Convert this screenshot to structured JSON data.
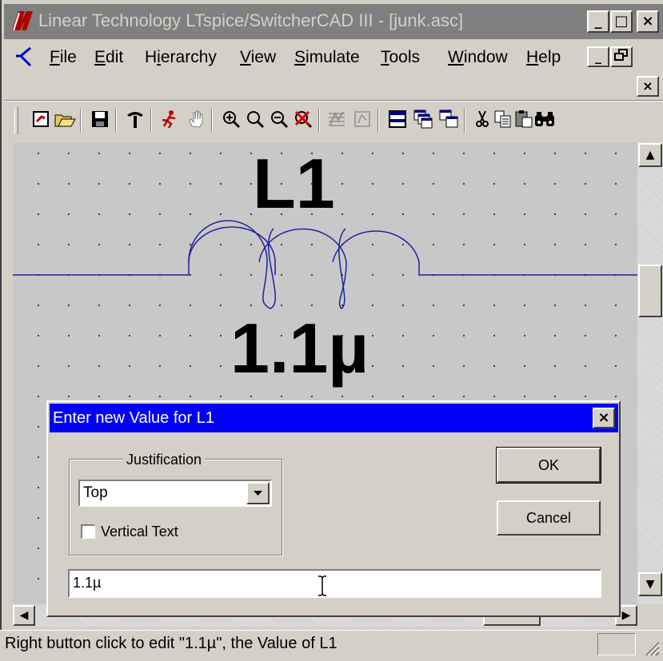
{
  "window": {
    "title": "Linear Technology LTspice/SwitcherCAD III - [junk.asc]",
    "minimize": "_",
    "maximize": "□",
    "close": "×"
  },
  "menu": {
    "items": [
      "File",
      "Edit",
      "Hierarchy",
      "View",
      "Simulate",
      "Tools",
      "Window",
      "Help"
    ],
    "mnemonics": [
      "F",
      "E",
      "i",
      "V",
      "S",
      "T",
      "W",
      "H"
    ],
    "doc_min": "_",
    "doc_restore": "🗗",
    "doc_close": "×"
  },
  "toolbar": {
    "icons": [
      "new-schematic-icon",
      "open-icon",
      "save-icon",
      "control-panel-icon",
      "run-icon",
      "pan-hand-icon",
      "zoom-in-icon",
      "zoom-fit-icon",
      "zoom-out-icon",
      "cancel-zoom-icon",
      "pick-visible-traces-icon",
      "autorange-icon",
      "tile-horizontal-icon",
      "cascade-icon",
      "tile-vertical-icon",
      "cut-icon",
      "copy-icon",
      "paste-icon",
      "find-icon"
    ]
  },
  "schematic": {
    "ref_label": "L1",
    "value_label": "1.1µ",
    "wire_color": "#2020a0",
    "background": "#c8c8c8"
  },
  "scroll": {
    "up": "▲",
    "down": "▼",
    "left": "◀",
    "right": "▶"
  },
  "dialog": {
    "title": "Enter new Value for L1",
    "close": "×",
    "justification_label": "Justification",
    "justification_value": "Top",
    "vertical_text_label": "Vertical Text",
    "vertical_text_checked": false,
    "ok_label": "OK",
    "cancel_label": "Cancel",
    "value_input": "1.1µ",
    "title_color": "#0000f8"
  },
  "status": {
    "text": "Right button click to edit \"1.1µ\", the Value of L1"
  }
}
